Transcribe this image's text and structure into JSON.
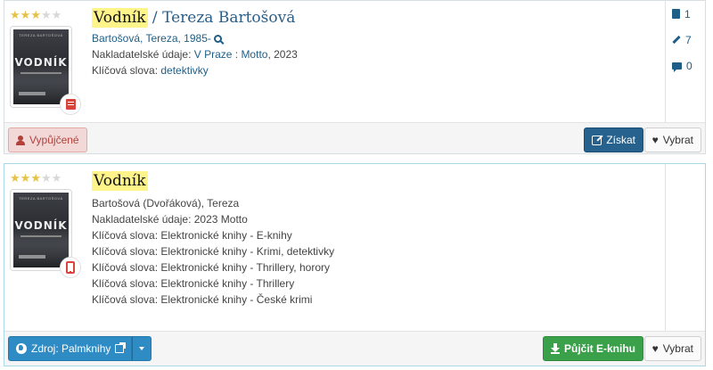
{
  "records": [
    {
      "rating": 3,
      "title": "Vodník",
      "responsibility": " / Tereza Bartošová",
      "cover_top": "TEREZA BARTOŠOVÁ",
      "cover_title": "VODNÍK",
      "format_icon": "book-icon",
      "author": "Bartošová, Tereza, 1985-",
      "publisher_label": "Nakladatelské údaje: ",
      "publisher_value": "V Praze : Motto",
      "publisher_year": ", 2023",
      "keywords_label": "Klíčová slova: ",
      "keywords_value": "detektivky",
      "side": {
        "copies": "1",
        "editions": "7",
        "comments": "0"
      },
      "buttons": {
        "borrowed": "Vypůjčené",
        "get": "Získat",
        "select": "Vybrat"
      }
    },
    {
      "rating": 3,
      "title": "Vodník",
      "cover_top": "TEREZA BARTOŠOVÁ",
      "cover_title": "VODNÍK",
      "format_icon": "tablet-icon",
      "author": "Bartošová (Dvořáková), Tereza",
      "publisher": "Nakladatelské údaje: 2023 Motto",
      "keywords": [
        "Klíčová slova: Elektronické knihy - E-knihy",
        "Klíčová slova: Elektronické knihy - Krimi, detektivky",
        "Klíčová slova: Elektronické knihy - Thrillery, horory",
        "Klíčová slova: Elektronické knihy - Thrillery",
        "Klíčová slova: Elektronické knihy - České krimi"
      ],
      "buttons": {
        "source": "Zdroj: Palmknihy",
        "borrow_ebook": "Půjčit E-knihu",
        "select": "Vybrat"
      }
    }
  ],
  "colors": {
    "highlight": "#fff48a",
    "link": "#1f5e86",
    "primary": "#27628f",
    "success": "#3aa04a",
    "info": "#2f8bc4",
    "danger": "#b2413c"
  }
}
